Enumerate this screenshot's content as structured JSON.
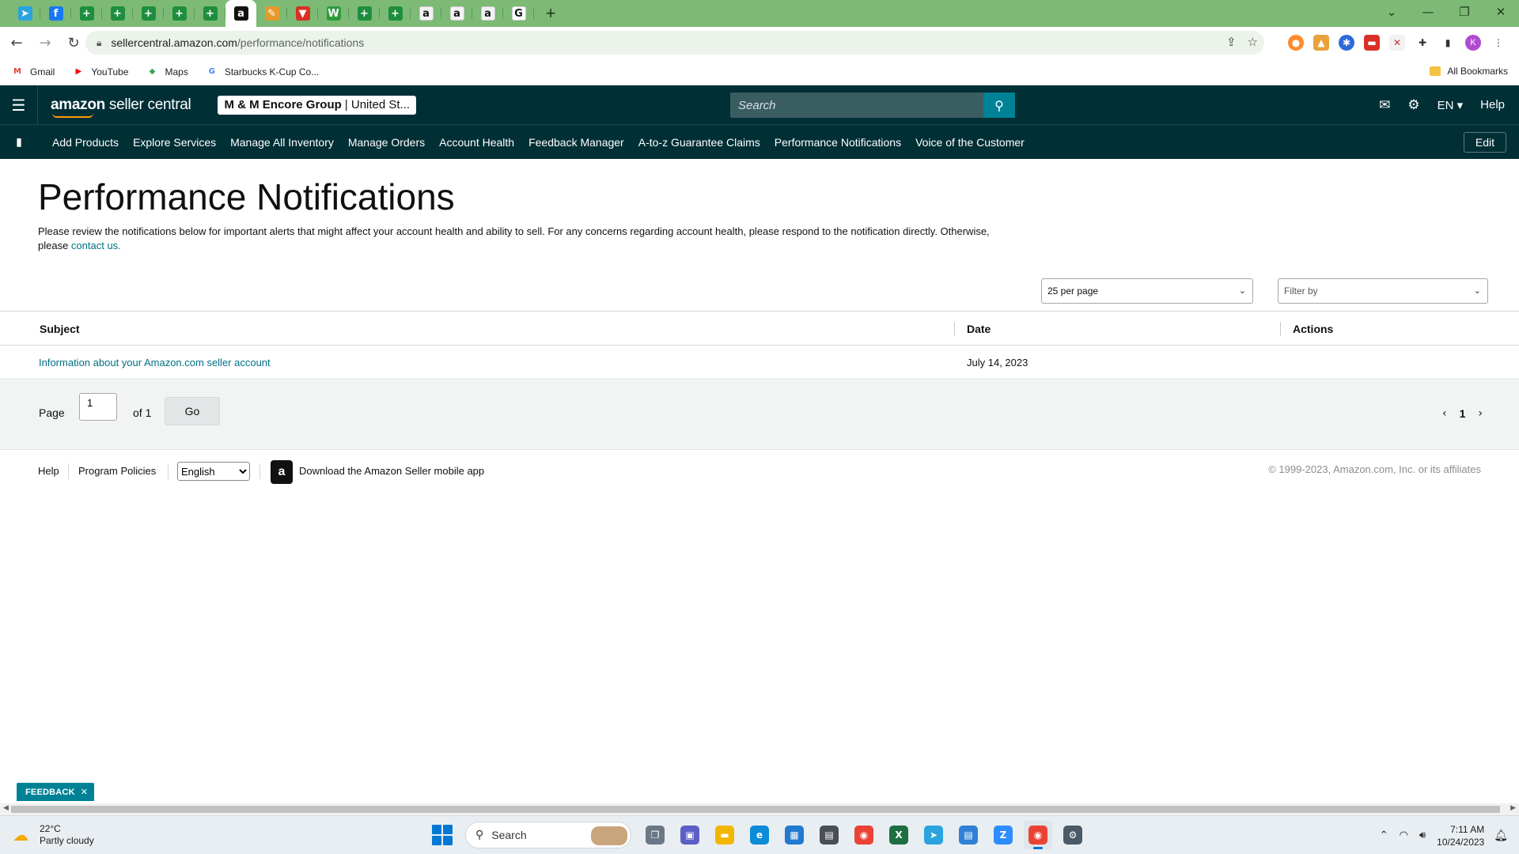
{
  "browser": {
    "tabs": [
      {
        "icon": "telegram-icon",
        "glyph": "➤",
        "color": "#2aa3de",
        "active": false
      },
      {
        "icon": "facebook-icon",
        "glyph": "f",
        "color": "#1877f2",
        "active": false
      },
      {
        "icon": "spreadsheet-plus-icon",
        "glyph": "+",
        "color": "#1e8e3e",
        "active": false
      },
      {
        "icon": "spreadsheet-plus-icon",
        "glyph": "+",
        "color": "#1e8e3e",
        "active": false
      },
      {
        "icon": "spreadsheet-plus-icon",
        "glyph": "+",
        "color": "#1e8e3e",
        "active": false
      },
      {
        "icon": "spreadsheet-plus-icon",
        "glyph": "+",
        "color": "#1e8e3e",
        "active": false
      },
      {
        "icon": "spreadsheet-plus-icon",
        "glyph": "+",
        "color": "#1e8e3e",
        "active": false
      },
      {
        "icon": "amazon-icon",
        "glyph": "a",
        "color": "#111111",
        "active": true
      },
      {
        "icon": "pencil-icon",
        "glyph": "✎",
        "color": "#e59a2a",
        "active": false
      },
      {
        "icon": "shield-red-icon",
        "glyph": "▼",
        "color": "#d93025",
        "active": false
      },
      {
        "icon": "w-logo-icon",
        "glyph": "W",
        "color": "#2e9c3a",
        "active": false
      },
      {
        "icon": "spreadsheet-plus-icon",
        "glyph": "+",
        "color": "#1e8e3e",
        "active": false
      },
      {
        "icon": "spreadsheet-plus-icon",
        "glyph": "+",
        "color": "#1e8e3e",
        "active": false
      },
      {
        "icon": "amazon-icon",
        "glyph": "a",
        "color": "#f3f3f3",
        "active": false
      },
      {
        "icon": "amazon-icon",
        "glyph": "a",
        "color": "#f3f3f3",
        "active": false
      },
      {
        "icon": "amazon-icon",
        "glyph": "a",
        "color": "#f3f3f3",
        "active": false
      },
      {
        "icon": "google-icon",
        "glyph": "G",
        "color": "#ffffff",
        "active": false
      }
    ],
    "url_host": "sellercentral.amazon.com",
    "url_path": "/performance/notifications",
    "bookmarks": [
      {
        "label": "Gmail",
        "icon": "gmail-icon",
        "glyph": "M",
        "color": "#ea4335"
      },
      {
        "label": "YouTube",
        "icon": "youtube-icon",
        "glyph": "▶",
        "color": "#ff0000"
      },
      {
        "label": "Maps",
        "icon": "maps-icon",
        "glyph": "◆",
        "color": "#34a853"
      },
      {
        "label": "Starbucks K-Cup Co...",
        "icon": "google-icon",
        "glyph": "G",
        "color": "#4285f4"
      }
    ],
    "all_bookmarks": "All Bookmarks",
    "profile_initial": "K"
  },
  "header": {
    "logo_bold": "amazon",
    "logo_rest": " seller central",
    "store_name": "M & M Encore Group",
    "store_region": "| United St...",
    "search_placeholder": "Search",
    "language": "EN",
    "help": "Help"
  },
  "nav": {
    "items": [
      "Add Products",
      "Explore Services",
      "Manage All Inventory",
      "Manage Orders",
      "Account Health",
      "Feedback Manager",
      "A-to-z Guarantee Claims",
      "Performance Notifications",
      "Voice of the Customer"
    ],
    "edit": "Edit"
  },
  "page": {
    "title": "Performance Notifications",
    "intro_text": "Please review the notifications below for important alerts that might affect your account health and ability to sell. For any concerns regarding account health, please respond to the notification directly. Otherwise, please ",
    "intro_link": "contact us.",
    "per_page": "25 per page",
    "filter_placeholder": "Filter by"
  },
  "table": {
    "columns": {
      "subject": "Subject",
      "date": "Date",
      "actions": "Actions"
    },
    "rows": [
      {
        "subject": "Information about your Amazon.com seller account",
        "date": "July 14, 2023",
        "actions": ""
      }
    ]
  },
  "pagination": {
    "page_label": "Page",
    "current_page": "1",
    "of_label": "of 1",
    "go": "Go",
    "page_number": "1"
  },
  "footer": {
    "help": "Help",
    "program_policies": "Program Policies",
    "language": "English",
    "app_text": "Download the Amazon Seller mobile app",
    "copyright": "© 1999-2023, Amazon.com, Inc. or its affiliates"
  },
  "feedback": {
    "label": "FEEDBACK"
  },
  "taskbar": {
    "temperature": "22°C",
    "weather": "Partly cloudy",
    "search": "Search",
    "apps": [
      {
        "icon": "task-view-icon",
        "glyph": "❐",
        "color": "#6b7785",
        "active": false
      },
      {
        "icon": "teams-chat-icon",
        "glyph": "▣",
        "color": "#5b5fc7",
        "active": false
      },
      {
        "icon": "file-explorer-icon",
        "glyph": "▬",
        "color": "#f2b600",
        "active": false
      },
      {
        "icon": "edge-icon",
        "glyph": "e",
        "color": "#0c8bd8",
        "active": false
      },
      {
        "icon": "store-icon",
        "glyph": "▦",
        "color": "#1f7ad0",
        "active": false
      },
      {
        "icon": "calculator-icon",
        "glyph": "▤",
        "color": "#4a4f57",
        "active": false
      },
      {
        "icon": "chrome-icon",
        "glyph": "◉",
        "color": "#ea4335",
        "active": false
      },
      {
        "icon": "excel-icon",
        "glyph": "X",
        "color": "#1d6f42",
        "active": false
      },
      {
        "icon": "telegram-icon",
        "glyph": "➤",
        "color": "#2aa3de",
        "active": false
      },
      {
        "icon": "notepad-icon",
        "glyph": "▤",
        "color": "#2f80d6",
        "active": false
      },
      {
        "icon": "zoom-icon",
        "glyph": "Z",
        "color": "#2d8cff",
        "active": false
      },
      {
        "icon": "chrome-icon",
        "glyph": "◉",
        "color": "#ea4335",
        "active": true
      },
      {
        "icon": "settings-icon",
        "glyph": "⚙",
        "color": "#4c5a67",
        "active": false
      }
    ],
    "time": "7:11 AM",
    "date": "10/24/2023"
  }
}
